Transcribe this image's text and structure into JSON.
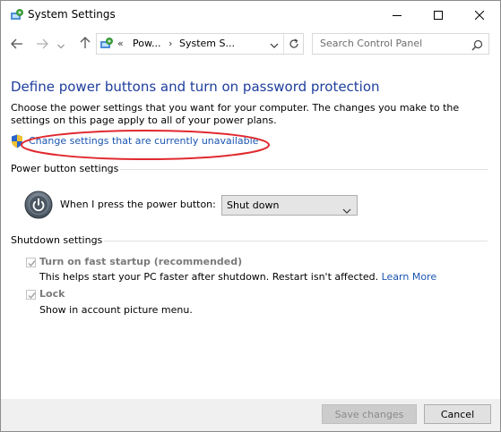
{
  "window": {
    "title": "System Settings",
    "icons": {
      "app": "control-panel-icon",
      "minimize": "minimize-icon",
      "maximize": "maximize-icon",
      "close": "close-icon"
    }
  },
  "navigation": {
    "address_chevron": "«",
    "breadcrumb": [
      "Pow...",
      "System S..."
    ],
    "separator": "›",
    "search_placeholder": "Search Control Panel",
    "icons": {
      "back": "back-arrow-icon",
      "forward": "forward-arrow-icon",
      "recent": "chevron-down-icon",
      "up": "up-arrow-icon",
      "refresh": "refresh-icon",
      "search": "search-icon"
    }
  },
  "content": {
    "heading": "Define power buttons and turn on password protection",
    "intro": "Choose the power settings that you want for your computer. The changes you make to the settings on this page apply to all of your power plans.",
    "change_link": "Change settings that are currently unavailable",
    "power_group_label": "Power button settings",
    "power_button_label": "When I press the power button:",
    "power_button_value": "Shut down",
    "shutdown_group_label": "Shutdown settings",
    "fast_startup": {
      "label": "Turn on fast startup (recommended)",
      "description": "This helps start your PC faster after shutdown. Restart isn't affected.",
      "link": "Learn More",
      "checked": true
    },
    "lock": {
      "label": "Lock",
      "description": "Show in account picture menu.",
      "checked": true
    }
  },
  "buttons": {
    "save": "Save changes",
    "cancel": "Cancel"
  },
  "colors": {
    "heading": "#1e3e9c",
    "link": "#1a55b0",
    "highlight": "#e0292f",
    "disabled_text": "#7a7a7a"
  }
}
